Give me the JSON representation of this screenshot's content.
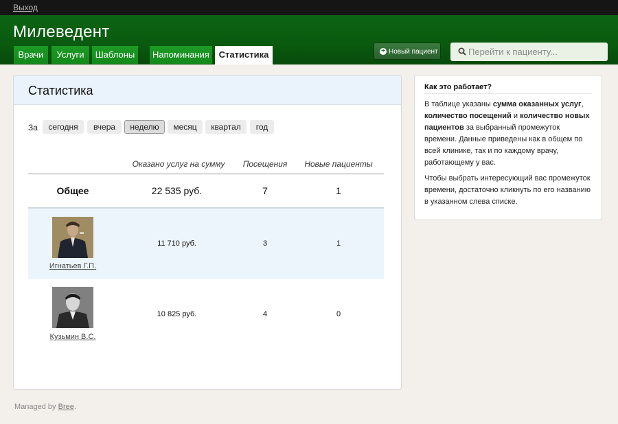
{
  "topbar": {
    "logout": "Выход"
  },
  "app": {
    "title": "Милеведент"
  },
  "tabs": [
    {
      "label": "Врачи"
    },
    {
      "label": "Услуги"
    },
    {
      "label": "Шаблоны"
    },
    {
      "label": "Напоминания"
    },
    {
      "label": "Статистика",
      "active": true
    }
  ],
  "header": {
    "new_patient": "Новый пациент",
    "search_placeholder": "Перейти к пациенту..."
  },
  "main": {
    "title": "Статистика",
    "period_label": "За",
    "periods": [
      "сегодня",
      "вчера",
      "неделю",
      "месяц",
      "квартал",
      "год"
    ],
    "selected_period": "неделю",
    "columns": [
      "Оказано услуг на сумму",
      "Посещения",
      "Новые пациенты"
    ],
    "total": {
      "label": "Общее",
      "sum": "22 535 руб.",
      "visits": "7",
      "new": "1"
    },
    "doctors": [
      {
        "name": "Игнатьев Г.П.",
        "sum": "11 710 руб.",
        "visits": "3",
        "new": "1"
      },
      {
        "name": "Кузьмин В.С.",
        "sum": "10 825 руб.",
        "visits": "4",
        "new": "0"
      }
    ]
  },
  "side": {
    "title": "Как это работает?",
    "p1": {
      "t1": "В таблице указаны ",
      "b1": "сумма оказанных услуг",
      "t2": ", ",
      "b2": "количество посещений",
      "t3": " и ",
      "b3": "количество новых пациентов",
      "t4": " за выбранный промежуток времени. Данные приведены как в общем по всей клинике, так и по каждому врачу, работающему у вас."
    },
    "p2": "Чтобы выбрать интересующий вас промежуток времени, достаточно кликнуть по его названию в указанном слева списке."
  },
  "footer": {
    "managed_by": "Managed by ",
    "link": "Bree",
    "dot": "."
  },
  "colors": {
    "header_green": "#0a5a0f",
    "tab_green": "#138a1b",
    "highlight_row": "#edf5fc"
  }
}
